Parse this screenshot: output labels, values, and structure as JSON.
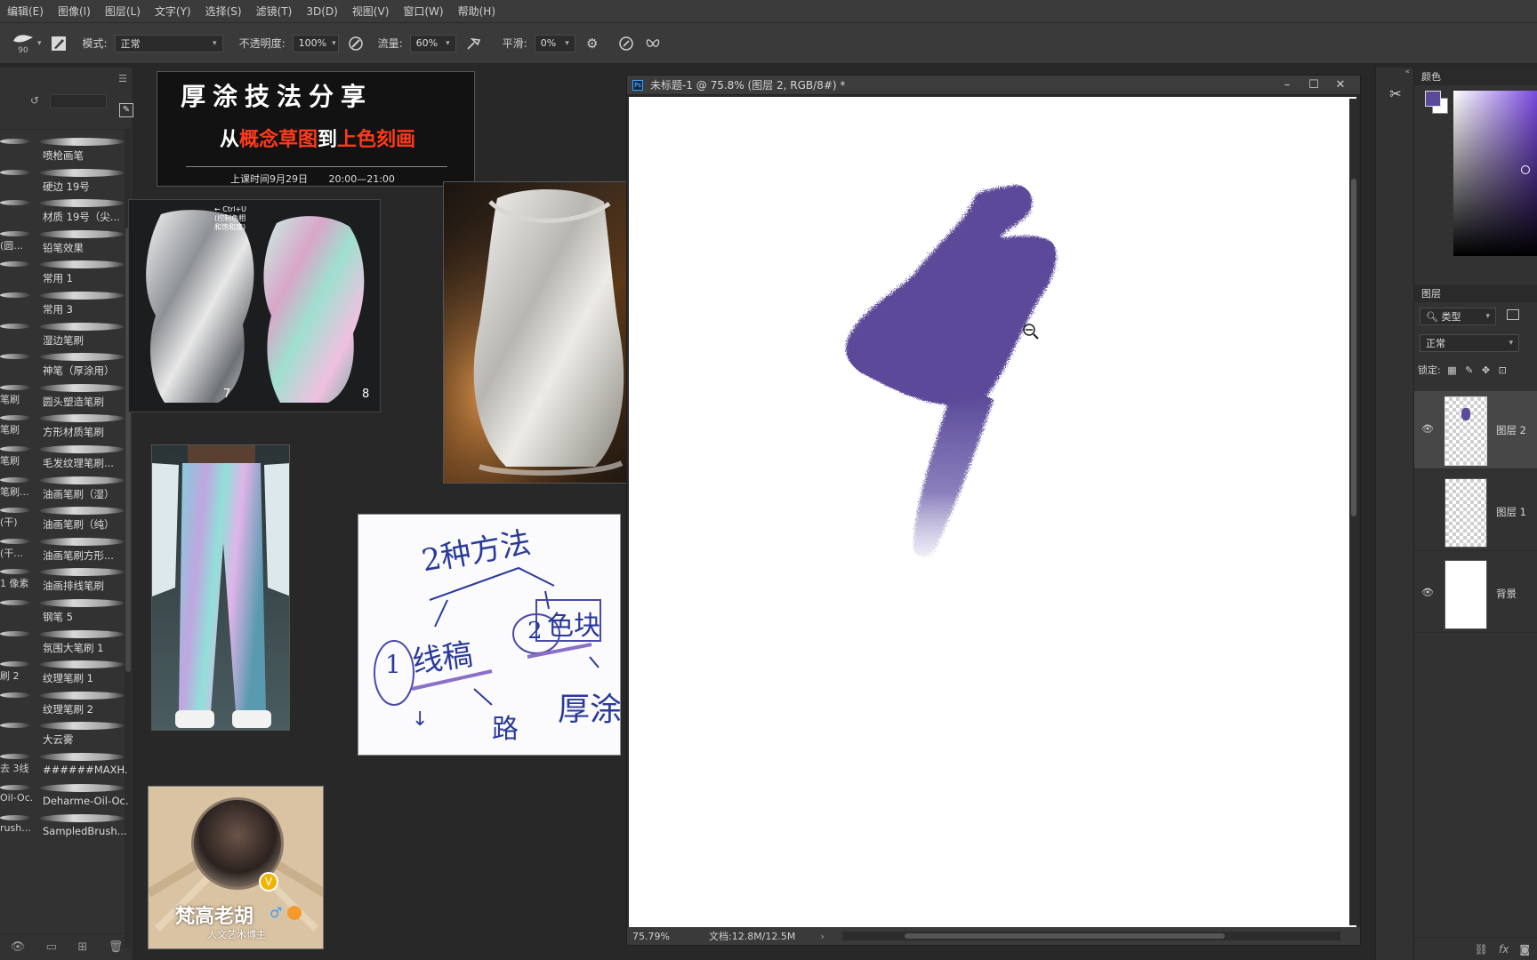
{
  "menu": [
    "编辑(E)",
    "图像(I)",
    "图层(L)",
    "文字(Y)",
    "选择(S)",
    "滤镜(T)",
    "3D(D)",
    "视图(V)",
    "窗口(W)",
    "帮助(H)"
  ],
  "options": {
    "brush_size": "90",
    "mode_label": "模式:",
    "mode_value": "正常",
    "opacity_label": "不透明度:",
    "opacity_value": "100%",
    "flow_label": "流量:",
    "flow_value": "60%",
    "smoothing_label": "平滑:",
    "smoothing_value": "0%"
  },
  "brushes": [
    {
      "left": "",
      "label": "喷枪画笔"
    },
    {
      "left": "",
      "label": "硬边 19号"
    },
    {
      "left": "",
      "label": "材质 19号（尖..."
    },
    {
      "left": "(圆...",
      "label": "铅笔效果"
    },
    {
      "left": "",
      "label": "常用 1"
    },
    {
      "left": "",
      "label": "常用 3"
    },
    {
      "left": "",
      "label": "湿边笔刷"
    },
    {
      "left": "",
      "label": "神笔（厚涂用）"
    },
    {
      "left": "笔刷",
      "label": "圆头塑造笔刷"
    },
    {
      "left": "笔刷",
      "label": "方形材质笔刷"
    },
    {
      "left": "笔刷",
      "label": "毛发纹理笔刷..."
    },
    {
      "left": "笔刷...",
      "label": "油画笔刷（湿）"
    },
    {
      "left": "(干)",
      "label": "油画笔刷（纯）"
    },
    {
      "left": "(干...",
      "label": "油画笔刷方形..."
    },
    {
      "left": "1 像素",
      "label": "油画排线笔刷"
    },
    {
      "left": "",
      "label": "钢笔 5"
    },
    {
      "left": "",
      "label": "氛围大笔刷 1"
    },
    {
      "left": "刷 2",
      "label": "纹理笔刷 1"
    },
    {
      "left": "",
      "label": "纹理笔刷 2"
    },
    {
      "left": "",
      "label": "大云雾"
    },
    {
      "left": "去 3线",
      "label": "######MAXH..."
    },
    {
      "left": "Oil-Oc...",
      "label": "Deharme-Oil-Oc..."
    },
    {
      "left": "rush...",
      "label": "SampledBrush..."
    }
  ],
  "banner": {
    "title": "厚涂技法分享",
    "subtitle_white1": "从",
    "subtitle_red1": "概念草图",
    "subtitle_white2": "到",
    "subtitle_red2": "上色刻画",
    "time_label": "上课时间9月29日",
    "time_range": "20:00—21:00"
  },
  "ref_notes": {
    "arrow_note": "← Ctrl+U\n(控制色相\n和饱和度)",
    "num7": "7",
    "num8": "8"
  },
  "sketch_note": {
    "line1": "2种方法",
    "circle1": "1",
    "word1": "线稿",
    "circle2": "2",
    "word2": "色块",
    "bottom1": "↓",
    "bottom2": "路",
    "bottom3": "厚涂"
  },
  "avatar_card": {
    "name": "梵高老胡",
    "role": "人文艺术博主",
    "badge": "V"
  },
  "document": {
    "title": "未标题-1 @ 75.8% (图层 2, RGB/8#) *",
    "zoom": "75.79%",
    "doc_info": "文档:12.8M/12.5M"
  },
  "panels": {
    "color_tab": "颜色",
    "layers_tab": "图层",
    "filter_label": "类型",
    "blend_mode": "正常",
    "lock_label": "锁定:",
    "layers": [
      {
        "name": "图层 2",
        "visible": true
      },
      {
        "name": "图层 1",
        "visible": false
      },
      {
        "name": "背景",
        "visible": true
      }
    ]
  },
  "colors": {
    "foreground": "#5b4a9a",
    "paint_stroke": "#5b4a99"
  }
}
